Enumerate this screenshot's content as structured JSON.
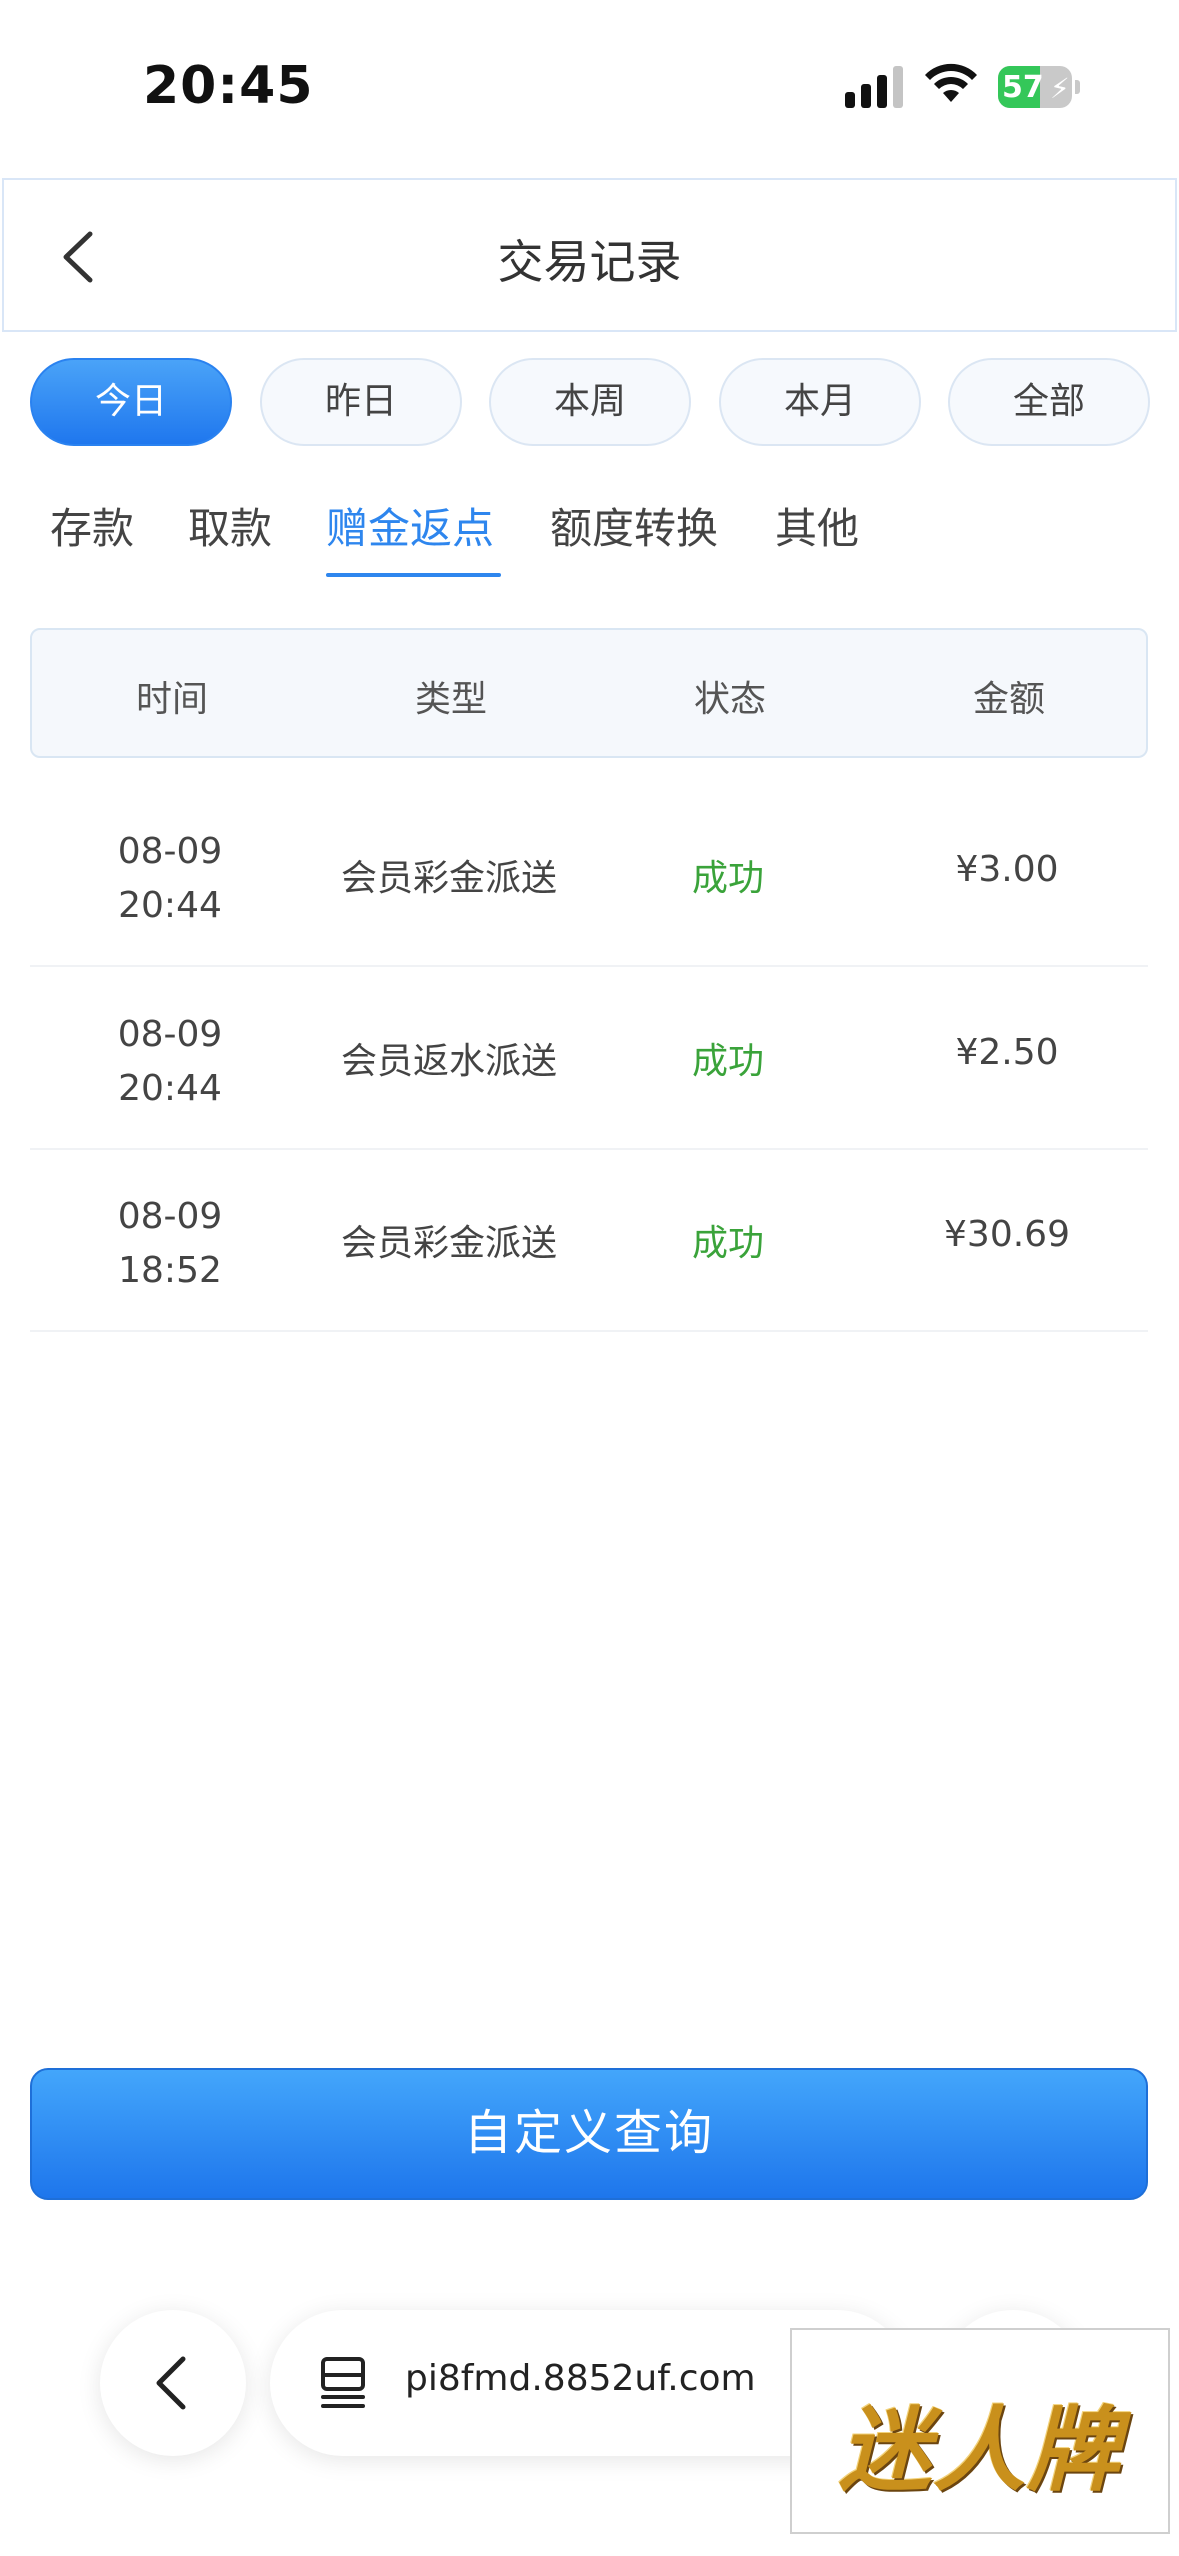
{
  "status_bar": {
    "time": "20:45",
    "battery_pct": "57",
    "battery_level": 0.57
  },
  "header": {
    "title": "交易记录"
  },
  "period_chips": [
    {
      "label": "今日",
      "active": true
    },
    {
      "label": "昨日",
      "active": false
    },
    {
      "label": "本周",
      "active": false
    },
    {
      "label": "本月",
      "active": false
    },
    {
      "label": "全部",
      "active": false
    }
  ],
  "category_tabs": [
    {
      "label": "存款",
      "active": false
    },
    {
      "label": "取款",
      "active": false
    },
    {
      "label": "赠金返点",
      "active": true
    },
    {
      "label": "额度转换",
      "active": false
    },
    {
      "label": "其他",
      "active": false
    }
  ],
  "table": {
    "columns": [
      "时间",
      "类型",
      "状态",
      "金额"
    ],
    "rows": [
      {
        "date": "08-09",
        "time": "20:44",
        "type": "会员彩金派送",
        "status": "成功",
        "amount": "¥3.00"
      },
      {
        "date": "08-09",
        "time": "20:44",
        "type": "会员返水派送",
        "status": "成功",
        "amount": "¥2.50"
      },
      {
        "date": "08-09",
        "time": "18:52",
        "type": "会员彩金派送",
        "status": "成功",
        "amount": "¥30.69"
      }
    ]
  },
  "query_button": {
    "label": "自定义查询"
  },
  "browser": {
    "url": "pi8fmd.8852uf.com"
  },
  "watermark": {
    "text": "迷人牌"
  },
  "colors": {
    "accent": "#2e86ee",
    "success": "#3aa33a",
    "chip_active": "#1f77ee"
  },
  "icons": {
    "back": "chevron-left-icon",
    "tabs": "tab-overview-icon",
    "wifi": "wifi-icon",
    "signal": "cellular-signal-icon",
    "battery": "battery-icon"
  }
}
